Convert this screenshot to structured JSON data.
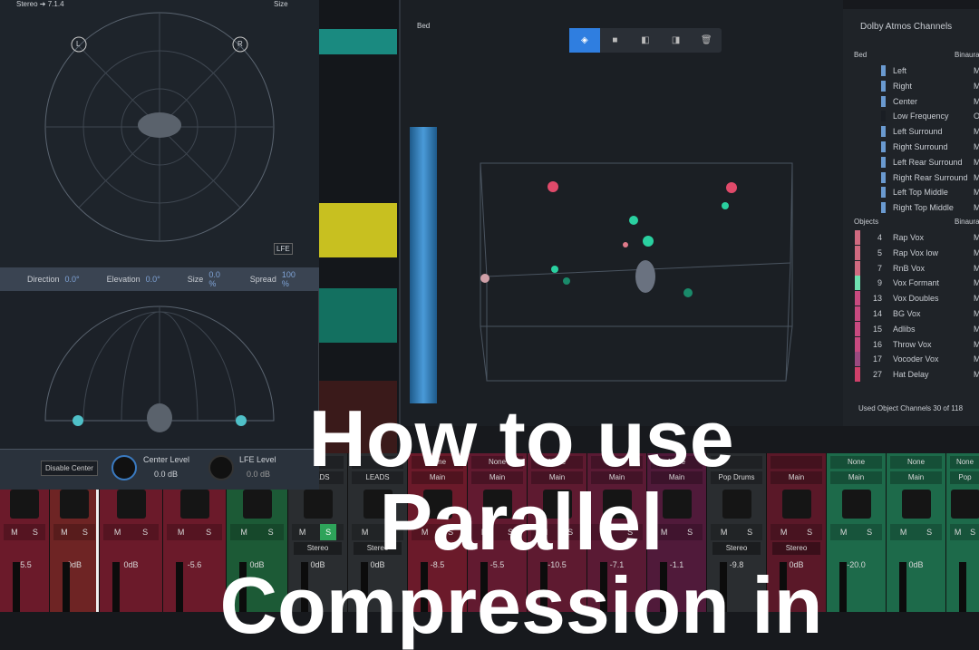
{
  "panner": {
    "format": "Stereo ➔ 7.1.4",
    "size_label": "Size",
    "left_label": "L",
    "right_label": "R",
    "lfe_label": "LFE",
    "params": [
      {
        "label": "Direction",
        "value": "0.0°"
      },
      {
        "label": "Elevation",
        "value": "0.0°"
      },
      {
        "label": "Size",
        "value": "0.0 %"
      },
      {
        "label": "Spread",
        "value": "100 %"
      }
    ],
    "disable_center": "Disable Center",
    "center_level_label": "Center Level",
    "center_level": "0.0 dB",
    "lfe_level_label": "LFE Level",
    "lfe_level": "0.0 dB"
  },
  "view3d": {
    "bed_label": "Bed",
    "toolbar": [
      "cube-icon",
      "square-icon",
      "left-panel-icon",
      "right-panel-icon",
      "trash-icon"
    ]
  },
  "dolby": {
    "title": "Dolby Atmos Channels",
    "bed_label": "Bed",
    "binaural_label": "Binaura",
    "objects_label": "Objects",
    "bed": [
      {
        "name": "Left",
        "mode": "M"
      },
      {
        "name": "Right",
        "mode": "M"
      },
      {
        "name": "Center",
        "mode": "M"
      },
      {
        "name": "Low Frequency",
        "mode": "O"
      },
      {
        "name": "Left Surround",
        "mode": "M"
      },
      {
        "name": "Right Surround",
        "mode": "M"
      },
      {
        "name": "Left Rear Surround",
        "mode": "M"
      },
      {
        "name": "Right Rear Surround",
        "mode": "M"
      },
      {
        "name": "Left Top Middle",
        "mode": "M"
      },
      {
        "name": "Right Top Middle",
        "mode": "M"
      }
    ],
    "objects": [
      {
        "num": "4",
        "name": "Rap Vox",
        "color": "#d06a80"
      },
      {
        "num": "5",
        "name": "Rap Vox low",
        "color": "#d06a80"
      },
      {
        "num": "7",
        "name": "RnB Vox",
        "color": "#d06a80"
      },
      {
        "num": "9",
        "name": "Vox Formant",
        "color": "#6fe0b0"
      },
      {
        "num": "13",
        "name": "Vox Doubles",
        "color": "#c84a80"
      },
      {
        "num": "14",
        "name": "BG Vox",
        "color": "#c84a80"
      },
      {
        "num": "15",
        "name": "Adlibs",
        "color": "#c84a80"
      },
      {
        "num": "16",
        "name": "Throw Vox",
        "color": "#c84a80"
      },
      {
        "num": "17",
        "name": "Vocoder Vox",
        "color": "#9a4a80"
      },
      {
        "num": "27",
        "name": "Hat Delay",
        "color": "#d0406a"
      }
    ],
    "used": "Used Object Channels  30 of 118"
  },
  "mixer": [
    {
      "w": 55,
      "color": "#6b1a2a",
      "top": "",
      "bottom": "",
      "db": "-5.5",
      "stereo": ""
    },
    {
      "w": 55,
      "color": "#6e2424",
      "top": "",
      "bottom": "",
      "db": "0dB",
      "stereo": ""
    },
    {
      "w": 70,
      "color": "#6b1a2a",
      "top": "",
      "bottom": "",
      "db": "0dB",
      "stereo": ""
    },
    {
      "w": 70,
      "color": "#6b1a2a",
      "top": "",
      "bottom": "",
      "db": "-5.6",
      "stereo": ""
    },
    {
      "w": 68,
      "color": "#1c5a36",
      "top": "",
      "bottom": "",
      "db": "0dB",
      "stereo": ""
    },
    {
      "w": 66,
      "color": "#2a2d30",
      "top": "",
      "bottom": "LEADS",
      "db": "0dB",
      "stereo": "Stereo",
      "solo": true
    },
    {
      "w": 66,
      "color": "#2a2d30",
      "top": "",
      "bottom": "LEADS",
      "db": "0dB",
      "stereo": "Stereo"
    },
    {
      "w": 66,
      "color": "#6b1a2a",
      "top": "None",
      "bottom": "Main",
      "db": "-8.5",
      "stereo": ""
    },
    {
      "w": 66,
      "color": "#621a30",
      "top": "None",
      "bottom": "Main",
      "db": "-5.5",
      "stereo": ""
    },
    {
      "w": 66,
      "color": "#5e1a30",
      "top": "None",
      "bottom": "Main",
      "db": "-10.5",
      "stereo": ""
    },
    {
      "w": 66,
      "color": "#5a1a34",
      "top": "None",
      "bottom": "Main",
      "db": "-7.1",
      "stereo": ""
    },
    {
      "w": 66,
      "color": "#501a3a",
      "top": "None",
      "bottom": "Main",
      "db": "-1.1",
      "stereo": ""
    },
    {
      "w": 66,
      "color": "#2a2d30",
      "top": "",
      "bottom": "Pop Drums",
      "db": "-9.8",
      "stereo": "Stereo"
    },
    {
      "w": 66,
      "color": "#5a1828",
      "top": "",
      "bottom": "Main",
      "db": "0dB",
      "stereo": "Stereo"
    },
    {
      "w": 66,
      "color": "#1d6a4a",
      "top": "None",
      "bottom": "Main",
      "db": "-20.0",
      "stereo": ""
    },
    {
      "w": 66,
      "color": "#1d6a4a",
      "top": "None",
      "bottom": "Main",
      "db": "0dB",
      "stereo": ""
    },
    {
      "w": 42,
      "color": "#1d6a4a",
      "top": "None",
      "bottom": "Pop",
      "db": "",
      "stereo": ""
    }
  ],
  "title": {
    "line1": "How to use",
    "line2": "Parallel",
    "line3": "Compression in"
  }
}
